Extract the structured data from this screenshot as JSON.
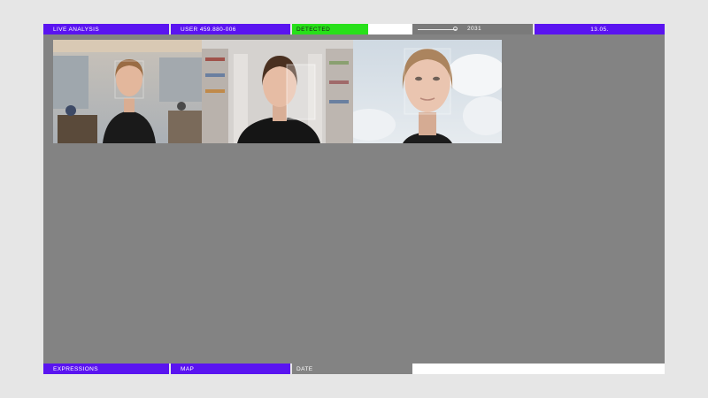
{
  "top_bar": {
    "live_analysis": "LIVE ANALYSIS",
    "user": "USER 459.880-006",
    "status": "DETECTED",
    "year": "2031",
    "date": "13.05."
  },
  "bottom_bar": {
    "expressions": "EXPRESSIONS",
    "map": "MAP",
    "date": "DATE"
  },
  "colors": {
    "accent": "#5a14f0",
    "detected": "#27e01a",
    "panel": "#838383"
  },
  "icons": [
    "timeline-knob-icon"
  ]
}
